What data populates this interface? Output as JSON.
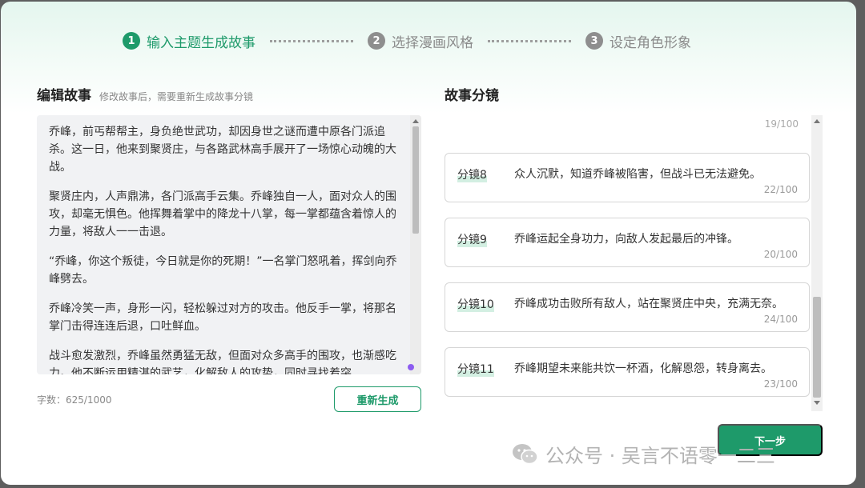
{
  "steps": [
    {
      "num": "1",
      "label": "输入主题生成故事",
      "active": true
    },
    {
      "num": "2",
      "label": "选择漫画风格",
      "active": false
    },
    {
      "num": "3",
      "label": "设定角色形象",
      "active": false
    }
  ],
  "editor": {
    "title": "编辑故事",
    "subtitle": "修改故事后，需要重新生成故事分镜",
    "paragraphs": [
      "乔峰，前丐帮帮主，身负绝世武功，却因身世之谜而遭中原各门派追杀。这一日，他来到聚贤庄，与各路武林高手展开了一场惊心动魄的大战。",
      "聚贤庄内，人声鼎沸，各门派高手云集。乔峰独自一人，面对众人的围攻，却毫无惧色。他挥舞着掌中的降龙十八掌，每一掌都蕴含着惊人的力量，将敌人一一击退。",
      "“乔峰，你这个叛徒，今日就是你的死期！”一名掌门怒吼着，挥剑向乔峰劈去。",
      "乔峰冷笑一声，身形一闪，轻松躲过对方的攻击。他反手一掌，将那名掌门击得连连后退，口吐鲜血。",
      "战斗愈发激烈，乔峰虽然勇猛无敌，但面对众多高手的围攻，也渐感吃力。他不断运用精湛的武艺，化解敌人的攻势，同时寻找着突"
    ],
    "char_count": "字数：625/1000",
    "regen_label": "重新生成"
  },
  "storyboard": {
    "title": "故事分镜",
    "top_count": "19/100",
    "cards": [
      {
        "label": "分镜8",
        "text": "众人沉默，知道乔峰被陷害，但战斗已无法避免。",
        "count": "22/100"
      },
      {
        "label": "分镜9",
        "text": "乔峰运起全身功力，向敌人发起最后的冲锋。",
        "count": "20/100"
      },
      {
        "label": "分镜10",
        "text": "乔峰成功击败所有敌人，站在聚贤庄中央，充满无奈。",
        "count": "24/100"
      },
      {
        "label": "分镜11",
        "text": "乔峰期望未来能共饮一杯酒，化解恩怨，转身离去。",
        "count": "23/100"
      }
    ]
  },
  "next_label": "下一步",
  "watermark": "公众号 · 吴言不语零一二三",
  "colors": {
    "accent": "#1e9a6a",
    "inactive": "#8e8e8e"
  }
}
